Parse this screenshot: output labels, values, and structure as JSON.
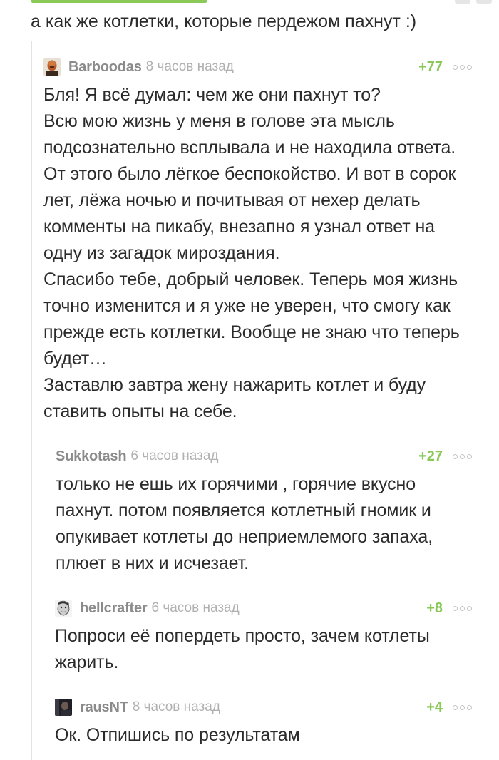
{
  "post_tail": "а как же котлетки, которые пердежом пахнут :)",
  "comments": [
    {
      "username": "Barboodas",
      "time": "8 часов назад",
      "rating": "+77",
      "avatar": "avatar-bald-man",
      "lines": [
        "Бля! Я всё думал: чем же они пахнут то?",
        "Всю мою жизнь у меня в голове эта мысль",
        "подсознательно всплывала и не находила ответа.",
        "От этого было лёгкое беспокойство. И вот в сорок",
        "лет, лёжа ночью и почитывая от нехер делать",
        "комменты на пикабу, внезапно я узнал ответ на",
        "одну из загадок мироздания.",
        "Спасибо тебе, добрый человек. Теперь моя жизнь",
        "точно изменится и я уже не уверен, что смогу как",
        "прежде есть котлетки. Вообще не знаю что теперь",
        "будет…",
        "Заставлю завтра жену нажарить котлет и буду",
        "ставить опыты на себе."
      ]
    },
    {
      "username": "Sukkotash",
      "time": "6 часов назад",
      "rating": "+27",
      "avatar": "",
      "lines": [
        "только не  ешь их  горячими , горячие вкусно",
        "пахнут.  потом появляется котлетный гномик и",
        "опукивает котлеты до неприемлемого запаха,",
        "плюет в них и исчезает."
      ]
    },
    {
      "username": "hellcrafter",
      "time": "6 часов назад",
      "rating": "+8",
      "avatar": "avatar-sketch-face",
      "lines": [
        "Попроси её попердеть просто, зачем котлеты",
        "жарить."
      ]
    },
    {
      "username": "rausNT",
      "time": "8 часов назад",
      "rating": "+4",
      "avatar": "avatar-dark-portrait",
      "lines": [
        "Ок. Отпишись по результатам"
      ]
    }
  ],
  "colors": {
    "rating_green": "#8ac858",
    "username_gray": "#8b8b8b",
    "time_gray": "#b0b0b0",
    "text": "#2b2b2b",
    "thread_line": "#e3e3e3"
  }
}
